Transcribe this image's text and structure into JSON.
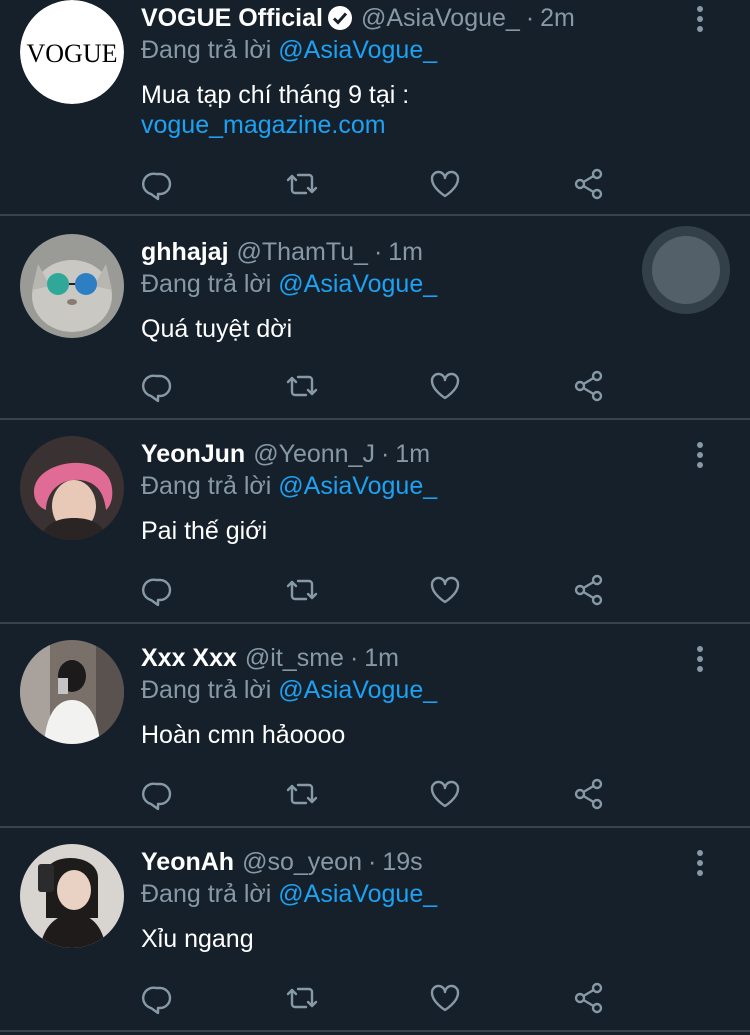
{
  "colors": {
    "background": "#15202b",
    "accent": "#1da1f2",
    "muted": "#8899a6",
    "divider": "#38444d"
  },
  "replies": [
    {
      "name": "VOGUE Official",
      "verified": true,
      "handle": "@AsiaVogue_",
      "time": "2m",
      "replying_prefix": "Đang trả lời",
      "replying_to": "@AsiaVogue_",
      "text_line1": "Mua tạp chí tháng 9 tại :",
      "text_link": "vogue_magazine.com",
      "avatar_text": "VOGUE"
    },
    {
      "name": "ghhajaj",
      "handle": "@ThamTu_",
      "time": "1m",
      "replying_prefix": "Đang trả lời",
      "replying_to": "@AsiaVogue_",
      "text_line1": "Quá tuyệt dời"
    },
    {
      "name": "YeonJun",
      "handle": "@Yeonn_J",
      "time": "1m",
      "replying_prefix": "Đang trả lời",
      "replying_to": "@AsiaVogue_",
      "text_line1": "Pai thế giới"
    },
    {
      "name": "Xxx Xxx",
      "handle": "@it_sme",
      "time": "1m",
      "replying_prefix": "Đang trả lời",
      "replying_to": "@AsiaVogue_",
      "text_line1": "Hoàn cmn hảoooo"
    },
    {
      "name": "YeonAh",
      "handle": "@so_yeon",
      "time": "19s",
      "replying_prefix": "Đang trả lời",
      "replying_to": "@AsiaVogue_",
      "text_line1": "Xỉu ngang"
    }
  ],
  "action_icons": [
    "reply-icon",
    "retweet-icon",
    "like-icon",
    "share-icon"
  ],
  "separator": "·"
}
